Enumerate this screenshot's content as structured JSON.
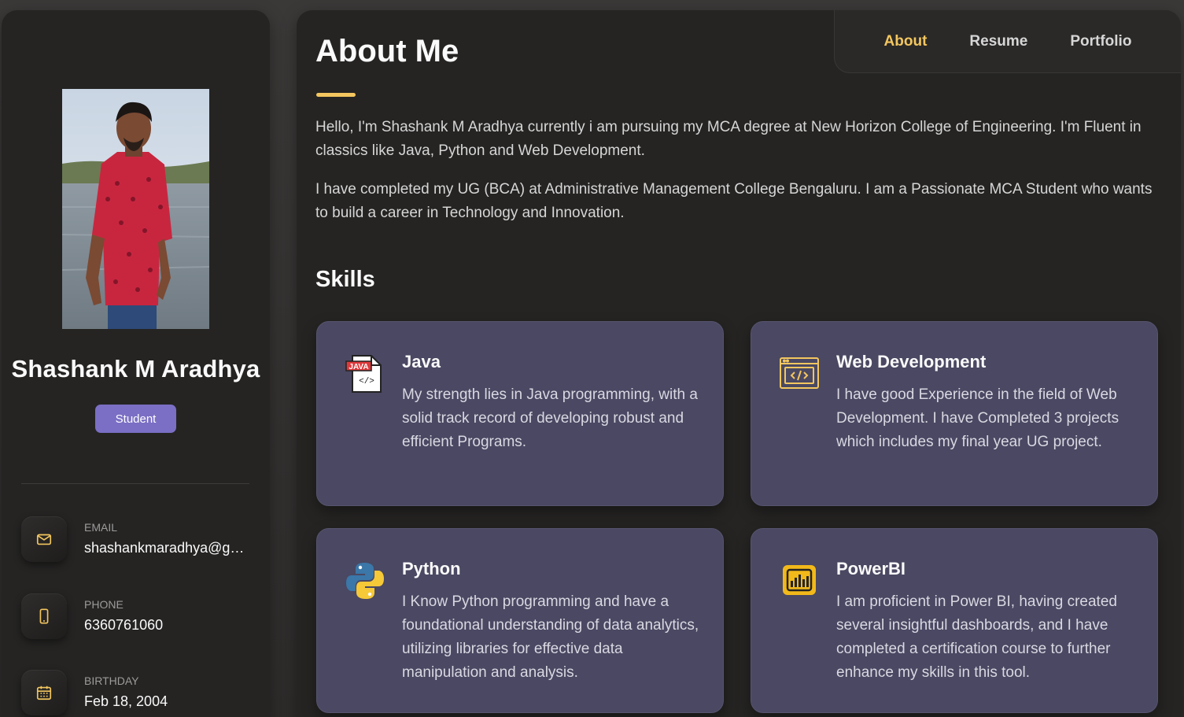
{
  "sidebar": {
    "name": "Shashank M Aradhya",
    "role": "Student",
    "contacts": [
      {
        "label": "EMAIL",
        "value": "shashankmaradhya@gmail.com",
        "icon": "mail-icon"
      },
      {
        "label": "PHONE",
        "value": "6360761060",
        "icon": "phone-icon"
      },
      {
        "label": "BIRTHDAY",
        "value": "Feb 18, 2004",
        "icon": "calendar-icon"
      }
    ]
  },
  "nav": {
    "items": [
      "About",
      "Resume",
      "Portfolio"
    ],
    "active": "About"
  },
  "about": {
    "title": "About Me",
    "paragraphs": [
      "Hello, I'm Shashank M Aradhya currently i am pursuing my MCA degree at New Horizon College of Engineering. I'm Fluent in classics like Java, Python and Web Development.",
      "I have completed my UG (BCA) at Administrative Management College Bengaluru. I am a Passionate MCA Student who wants to build a career in Technology and Innovation."
    ]
  },
  "skills": {
    "heading": "Skills",
    "items": [
      {
        "title": "Java",
        "description": "My strength lies in Java programming, with a solid track record of developing robust and efficient Programs.",
        "icon": "java-icon",
        "icon_text": "JAVA"
      },
      {
        "title": "Web Development",
        "description": "I have good Experience in the field of Web Development. I have Completed 3 projects which includes my final year UG project.",
        "icon": "web-code-icon"
      },
      {
        "title": "Python",
        "description": "I Know Python programming and have a foundational understanding of data analytics, utilizing libraries for effective data manipulation and analysis.",
        "icon": "python-icon"
      },
      {
        "title": "PowerBI",
        "description": "I am proficient in Power BI, having created several insightful dashboards, and I have completed a certification course to further enhance my skills in this tool.",
        "icon": "powerbi-icon"
      }
    ]
  },
  "colors": {
    "accent": "#f3c65f",
    "badge": "#7a6fc4",
    "card": "#4a4862",
    "panel": "#252423"
  }
}
